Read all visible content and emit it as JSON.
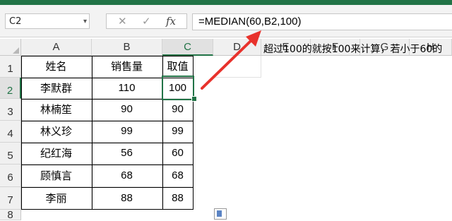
{
  "namebox": "C2",
  "formula_icons": {
    "cancel": "✕",
    "enter": "✓",
    "fx": "fx"
  },
  "formula": "=MEDIAN(60,B2,100)",
  "columns": [
    "A",
    "B",
    "C",
    "D",
    "E",
    "F",
    "G",
    "H"
  ],
  "rows": [
    "1",
    "2",
    "3",
    "4",
    "5",
    "6",
    "7",
    "8"
  ],
  "active_cell": "C2",
  "table": {
    "headers": [
      "姓名",
      "销售量",
      "取值"
    ],
    "rows": [
      [
        "李默群",
        "110",
        "100"
      ],
      [
        "林楠笙",
        "90",
        "90"
      ],
      [
        "林义珍",
        "99",
        "99"
      ],
      [
        "纪红海",
        "56",
        "60"
      ],
      [
        "顾慎言",
        "68",
        "68"
      ],
      [
        "李丽",
        "88",
        "88"
      ]
    ]
  },
  "note": "超过100的就按100来计算，若小于60的",
  "colors": {
    "excel_green": "#217346",
    "arrow_red": "#e8322c"
  },
  "icons": {
    "paste_options": "paste-options-icon",
    "arrow": "red-arrow-annotation"
  }
}
